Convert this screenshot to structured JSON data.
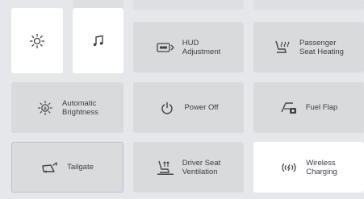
{
  "tiles": {
    "brightness": {
      "icon": "sun-icon"
    },
    "music": {
      "icon": "music-note-icon"
    },
    "hud": {
      "label": "HUD\nAdjustment",
      "icon": "hud-icon"
    },
    "passenger_heat": {
      "label": "Passenger\nSeat Heating",
      "icon": "seat-heating-icon"
    },
    "auto_brightness": {
      "label": "Automatic\nBrightness",
      "icon": "auto-brightness-icon"
    },
    "power_off": {
      "label": "Power Off",
      "icon": "power-icon"
    },
    "fuel_flap": {
      "label": "Fuel Flap",
      "icon": "fuel-flap-icon"
    },
    "tailgate": {
      "label": "Tailgate",
      "icon": "tailgate-icon"
    },
    "driver_vent": {
      "label": "Driver Seat\nVentilation",
      "icon": "seat-ventilation-icon"
    },
    "wireless": {
      "label": "Wireless\nCharging",
      "icon": "wireless-charging-icon"
    }
  }
}
